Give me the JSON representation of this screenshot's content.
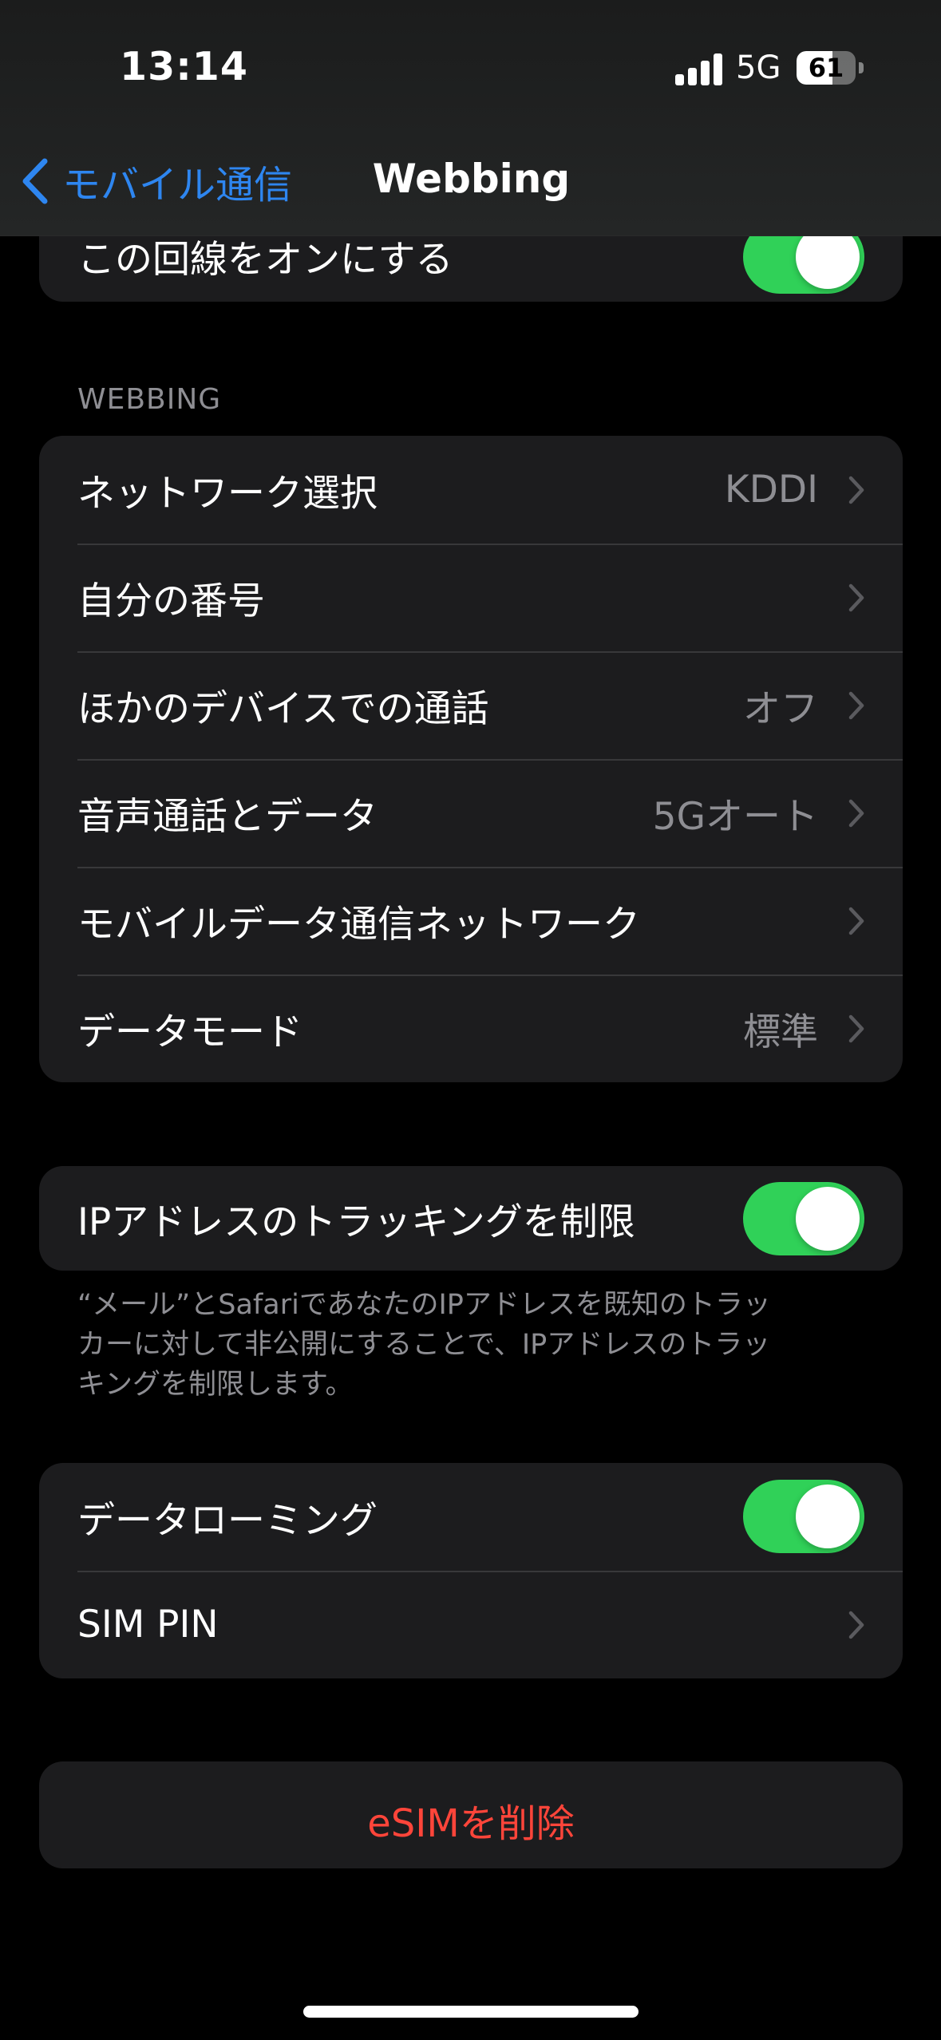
{
  "status_bar": {
    "time": "13:14",
    "network": "5G",
    "battery_level": "61",
    "battery_fraction": 0.61
  },
  "nav": {
    "back_label": "モバイル通信",
    "title": "Webbing"
  },
  "line_toggle": {
    "label": "この回線をオンにする",
    "on": true
  },
  "webbing_section": {
    "header": "WEBBING",
    "rows": [
      {
        "label": "ネットワーク選択",
        "value": "KDDI"
      },
      {
        "label": "自分の番号",
        "value": ""
      },
      {
        "label": "ほかのデバイスでの通話",
        "value": "オフ"
      },
      {
        "label": "音声通話とデータ",
        "value": "5Gオート"
      },
      {
        "label": "モバイルデータ通信ネットワーク",
        "value": ""
      },
      {
        "label": "データモード",
        "value": "標準"
      }
    ]
  },
  "ip_tracking": {
    "label": "IPアドレスのトラッキングを制限",
    "on": true,
    "footnote": "“メール”とSafariであなたのIPアドレスを既知のトラッカーに対して非公開にすることで、IPアドレスのトラッキングを制限します。"
  },
  "roaming_section": {
    "data_roaming_label": "データローミング",
    "data_roaming_on": true,
    "sim_pin_label": "SIM PIN"
  },
  "delete_esim": {
    "label": "eSIMを削除"
  },
  "colors": {
    "accent_blue": "#2e86f0",
    "toggle_green": "#30d158",
    "destructive_red": "#ff453a",
    "cell_background": "#1c1c1e",
    "secondary_text": "#8e8e93"
  },
  "icons": {
    "back": "chevron-left-icon",
    "disclosure": "chevron-right-icon",
    "signal": "cellular-signal-icon",
    "battery": "battery-icon"
  }
}
